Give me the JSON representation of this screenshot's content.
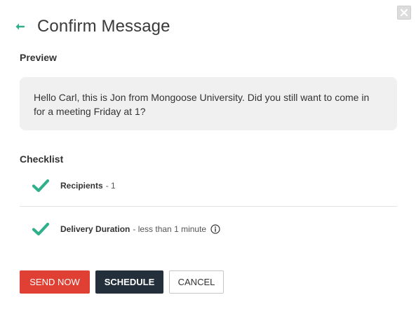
{
  "header": {
    "title": "Confirm Message",
    "back_icon": "arrow-left-icon",
    "close_icon": "close-icon"
  },
  "preview": {
    "label": "Preview",
    "message": "Hello Carl, this is Jon from Mongoose University. Did you still want to come in for a meeting Friday at 1?"
  },
  "checklist": {
    "label": "Checklist",
    "items": [
      {
        "name": "Recipients",
        "detail": "- 1",
        "status": "checked"
      },
      {
        "name": "Delivery Duration",
        "detail": "- less than 1 minute",
        "status": "checked",
        "has_info": true
      }
    ]
  },
  "actions": {
    "send_now": "SEND NOW",
    "schedule": "SCHEDULE",
    "cancel": "CANCEL"
  },
  "colors": {
    "accent_green": "#2fb08a",
    "send_red": "#e03f33",
    "schedule_dark": "#23303b",
    "preview_bg": "#f0f0f0"
  }
}
